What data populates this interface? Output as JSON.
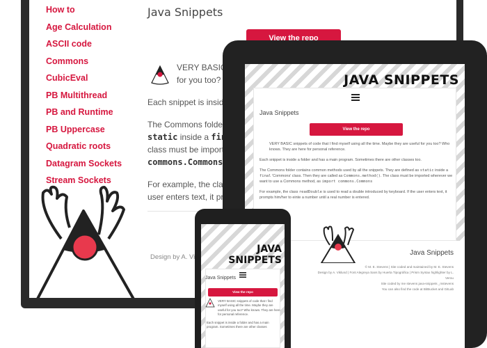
{
  "desktop": {
    "nav": [
      "How to",
      "Age Calculation",
      "ASCII code",
      "Commons",
      "CubicEval",
      "PB Multithread",
      "PB and Runtime",
      "PB Uppercase",
      "Quadratic roots",
      "Datagram Sockets",
      "Stream Sockets"
    ],
    "title": "Java Snippets",
    "button_label": "View the repo",
    "intro_a": "VERY BASIC snippe",
    "intro_b": "for you too? Who k",
    "p2": "Each snippet is inside a fo",
    "p3_a": "The Commons folder con",
    "p3_b_code": "static",
    "p3_b_text": "inside a",
    "p3_b_code2": "final",
    "p3_c": "class must be imported w",
    "p3_d_code": "commons.Commons",
    "p4_a": "For example, the class",
    "p4_a_code": "re",
    "p4_b": "user enters text, it promp",
    "footer": "Design by A. Vik"
  },
  "tablet": {
    "brand": "JAVA SNIPPETS",
    "title": "Java Snippets",
    "button_label": "View the repo",
    "p1": "VERY BASIC snippets of code that I find myself using all the time. Maybe they are useful for you too? Who knows. They are here for personal reference.",
    "p2": "Each snippet is inside a folder and has a main program. Sometimes there are other classes too.",
    "p3_a": "The Commons folder contains common methods used by all the snippets. They are defined as",
    "p3_code1": "static",
    "p3_b": "inside a",
    "p3_code2": "final",
    "p3_c": "'Commons' class. Then they are called as",
    "p3_code3": "Commons.method()",
    "p3_d": ". The class must be imported wherever we want to use a Commons method, as",
    "p3_code4": "import commons.Commons",
    "p4_a": "For example, the class",
    "p4_code": "readDouble",
    "p4_b": "is used to read a double introduced by keyboard. If the user enters text, it prompts him/her to einte a number until a real number is entered.",
    "footer_title": "Java Snippets",
    "footer_lines": [
      "© M. E. Stevens | Site coded and maintained by M. E. Stevens",
      "Design by A. Viklund | Font Alegreya Sans by Huerta Tipográfica | Prism Syntax highlighter by L. Verou",
      "Site coded by me stevens  java-snippets  _mstevens",
      "You can also find the code at  BitBucket and  GitLab"
    ]
  },
  "phone": {
    "brand_line1": "JAVA",
    "brand_line2": "SNIPPETS",
    "title": "Java Snippets",
    "button_label": "View the repo",
    "p1": "VERY BASIC snippets of code that I find myself using all the time. Maybe they are useful for you too? Who knows. They are here for personal reference.",
    "p2": "Each snippet is inside a folder and has a main program. Sometimes there are other classes"
  },
  "colors": {
    "accent": "#d6173f",
    "frame": "#222222"
  }
}
